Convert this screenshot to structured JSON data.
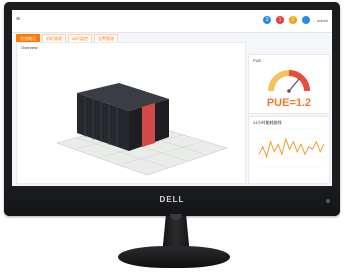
{
  "brand": "DELL",
  "app": {
    "menu_icon": "menu-icon",
    "top_icons": [
      {
        "name": "alert-icon-blue",
        "color": "#2a8ae8",
        "label": "3"
      },
      {
        "name": "alert-icon-red",
        "color": "#e63b3b",
        "label": "1"
      },
      {
        "name": "alert-icon-orange",
        "color": "#f2a21b",
        "label": "2"
      },
      {
        "name": "user-icon",
        "color": "#2a8ae8",
        "label": ""
      }
    ],
    "user_label": "admin",
    "tabs": [
      {
        "label": "总览概况",
        "active": true
      },
      {
        "label": "机柜管理",
        "active": false
      },
      {
        "label": "动环监控",
        "active": false
      },
      {
        "label": "告警管理",
        "active": false
      }
    ],
    "main_title": "Overview",
    "gauge_title": "PUE",
    "pue_value": "PUE=1.2",
    "chart_title": "24小时能耗曲线"
  },
  "chart_data": {
    "type": "line",
    "series": [
      {
        "values": [
          1.2,
          1.23,
          1.19,
          1.25,
          1.21,
          1.24,
          1.2,
          1.26,
          1.22,
          1.25,
          1.21,
          1.24,
          1.2,
          1.23,
          1.22,
          1.25,
          1.21,
          1.24
        ]
      }
    ]
  }
}
